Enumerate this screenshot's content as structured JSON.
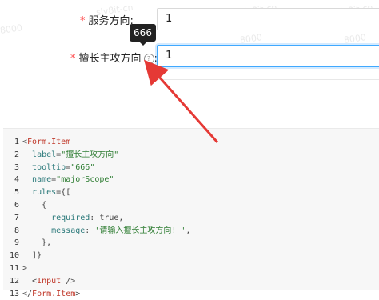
{
  "form": {
    "field1": {
      "label": "服务方向",
      "colon": ":",
      "value": "1"
    },
    "field2": {
      "label": "擅长主攻方向",
      "colon": ":",
      "value": "1",
      "help_glyph": "?"
    },
    "required_mark": "*",
    "tooltip": "666"
  },
  "code": {
    "line_numbers": [
      "1",
      "2",
      "3",
      "4",
      "5",
      "6",
      "7",
      "8",
      "9",
      "10",
      "11",
      "12",
      "13"
    ],
    "lines": [
      [
        {
          "t": "p",
          "v": "<"
        },
        {
          "t": "tag",
          "v": "Form.Item"
        }
      ],
      [
        {
          "t": "p",
          "v": "  "
        },
        {
          "t": "attr",
          "v": "label"
        },
        {
          "t": "p",
          "v": "="
        },
        {
          "t": "str",
          "v": "\"擅长主攻方向\""
        }
      ],
      [
        {
          "t": "p",
          "v": "  "
        },
        {
          "t": "attr",
          "v": "tooltip"
        },
        {
          "t": "p",
          "v": "="
        },
        {
          "t": "str",
          "v": "\"666\""
        }
      ],
      [
        {
          "t": "p",
          "v": "  "
        },
        {
          "t": "attr",
          "v": "name"
        },
        {
          "t": "p",
          "v": "="
        },
        {
          "t": "str",
          "v": "\"majorScope\""
        }
      ],
      [
        {
          "t": "p",
          "v": "  "
        },
        {
          "t": "attr",
          "v": "rules"
        },
        {
          "t": "p",
          "v": "={["
        }
      ],
      [
        {
          "t": "p",
          "v": "    {"
        }
      ],
      [
        {
          "t": "p",
          "v": "      "
        },
        {
          "t": "attr",
          "v": "required"
        },
        {
          "t": "p",
          "v": ": true,"
        }
      ],
      [
        {
          "t": "p",
          "v": "      "
        },
        {
          "t": "attr",
          "v": "message"
        },
        {
          "t": "p",
          "v": ": "
        },
        {
          "t": "str",
          "v": "'请输入擅长主攻方向! '"
        },
        {
          "t": "p",
          "v": ","
        }
      ],
      [
        {
          "t": "p",
          "v": "    },"
        }
      ],
      [
        {
          "t": "p",
          "v": "  ]}"
        }
      ],
      [
        {
          "t": "p",
          "v": ">"
        }
      ],
      [
        {
          "t": "p",
          "v": "  <"
        },
        {
          "t": "tag",
          "v": "Input"
        },
        {
          "t": "p",
          "v": " />"
        }
      ],
      [
        {
          "t": "p",
          "v": "</"
        },
        {
          "t": "tag",
          "v": "Form.Item"
        },
        {
          "t": "p",
          "v": ">"
        }
      ]
    ]
  },
  "colors": {
    "required": "#ff4d4f",
    "focus_border": "#40a9ff",
    "arrow": "#e53935",
    "tooltip_bg": "#222222"
  }
}
